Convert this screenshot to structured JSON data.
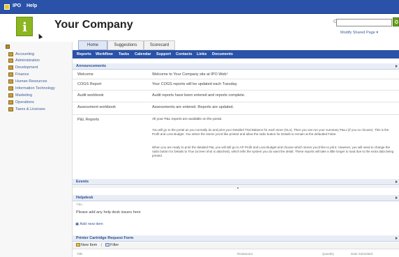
{
  "topbar": {
    "site_text": "IPO",
    "help_label": "Help"
  },
  "header": {
    "company_name": "Your Company",
    "modify_link": "Modify Shared Page ▾",
    "search_value": ""
  },
  "sidebar": {
    "items": [
      {
        "label": "Accounting"
      },
      {
        "label": "Administration"
      },
      {
        "label": "Development"
      },
      {
        "label": "Finance"
      },
      {
        "label": "Human Resources"
      },
      {
        "label": "Information Technology"
      },
      {
        "label": "Marketing"
      },
      {
        "label": "Operations"
      },
      {
        "label": "Taxes & Licenses"
      }
    ]
  },
  "tabs": [
    {
      "label": "Home"
    },
    {
      "label": "Suggestions"
    },
    {
      "label": "Scorecard"
    }
  ],
  "nav": {
    "links": [
      {
        "label": "Reports"
      },
      {
        "label": "Workflow"
      },
      {
        "label": "Tasks"
      },
      {
        "label": "Calendar"
      },
      {
        "label": "Support"
      },
      {
        "label": "Contacts"
      },
      {
        "label": "Links"
      },
      {
        "label": "Documents"
      }
    ]
  },
  "announcements": {
    "title": "Announcements",
    "rows": [
      {
        "title": "Welcome",
        "body": "Welcome to Your Company site at IPO Web!"
      },
      {
        "title": "COGS Report",
        "body": "Your COGS reports will be updated each Tuesday."
      },
      {
        "title": "Audit workbook",
        "body": "Audit reports have been entered and reports complete."
      },
      {
        "title": "Assessment workbook",
        "body": "Assessments are entered.  Reports are updated."
      },
      {
        "title": "P&L Reports",
        "body": "All your P&L reports are available on the portal."
      }
    ],
    "pl_paragraphs": [
      "You will go to the portal as you normally do and print your Detailed Trial Balance for each store (GLs). Then you can run your summary P&Ls (if you so choose). This is the Profit and Loss Budget. You select the stores you'd like printed and allow the radio button for Details to remain at the defaulted False.",
      "When you are ready to print the detailed P&L you will still go to AP Profit and Loss Budget and choose which stores you'd like to print. However, you will need to change the radio button for Details to True (screen shot is attached), which tells the system you do want the detail. These reports will take a little longer to load due to the extra data being printed."
    ]
  },
  "events": {
    "title": "Events"
  },
  "helpdesk": {
    "title": "Helpdesk",
    "column_title": "Title",
    "empty_text": "Please add any help desk issues here",
    "add_new": "▣ Add new item"
  },
  "printer": {
    "title": "Printer Cartridge Request Form",
    "new_item": "New Item",
    "filter": "Filter",
    "separator": "|",
    "columns": [
      {
        "label": "Title"
      },
      {
        "label": "Restaurant"
      },
      {
        "label": "Quantity"
      },
      {
        "label": "Date Submitted"
      }
    ]
  }
}
